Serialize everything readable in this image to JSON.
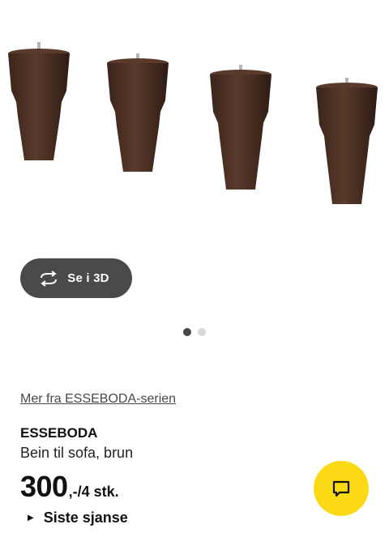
{
  "gallery": {
    "view3d_label": "Se i 3D",
    "dots": [
      true,
      false
    ],
    "colors": {
      "wood": "#4a2e22",
      "wood_dark": "#33201a",
      "bolt": "#b0b0b0"
    }
  },
  "product": {
    "series_link": "Mer fra ESSEBODA-serien",
    "name": "ESSEBODA",
    "description": "Bein til sofa, brun",
    "price_integer": "300",
    "price_suffix": ",-/4 stk.",
    "status": "Siste sjanse"
  },
  "chat": {
    "icon": "chat-icon",
    "color": "#fbd914"
  }
}
